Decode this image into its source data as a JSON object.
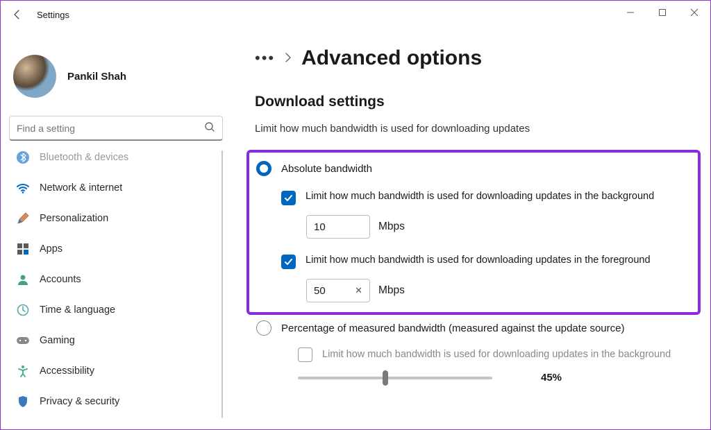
{
  "window": {
    "title": "Settings"
  },
  "profile": {
    "name": "Pankil Shah"
  },
  "search": {
    "placeholder": "Find a setting"
  },
  "sidebar": {
    "items": [
      {
        "key": "bluetooth",
        "label": "Bluetooth & devices"
      },
      {
        "key": "network",
        "label": "Network & internet"
      },
      {
        "key": "personalization",
        "label": "Personalization"
      },
      {
        "key": "apps",
        "label": "Apps"
      },
      {
        "key": "accounts",
        "label": "Accounts"
      },
      {
        "key": "time",
        "label": "Time & language"
      },
      {
        "key": "gaming",
        "label": "Gaming"
      },
      {
        "key": "accessibility",
        "label": "Accessibility"
      },
      {
        "key": "privacy",
        "label": "Privacy & security"
      }
    ]
  },
  "breadcrumb": {
    "dots": "•••",
    "title": "Advanced options"
  },
  "download": {
    "heading": "Download settings",
    "sub": "Limit how much bandwidth is used for downloading updates",
    "absolute": {
      "label": "Absolute bandwidth",
      "bg_label": "Limit how much bandwidth is used for downloading updates in the background",
      "bg_value": "10",
      "bg_unit": "Mbps",
      "fg_label": "Limit how much bandwidth is used for downloading updates in the foreground",
      "fg_value": "50",
      "fg_unit": "Mbps"
    },
    "percentage": {
      "label": "Percentage of measured bandwidth (measured against the update source)",
      "bg_label": "Limit how much bandwidth is used for downloading updates in the background",
      "value": "45%"
    }
  }
}
